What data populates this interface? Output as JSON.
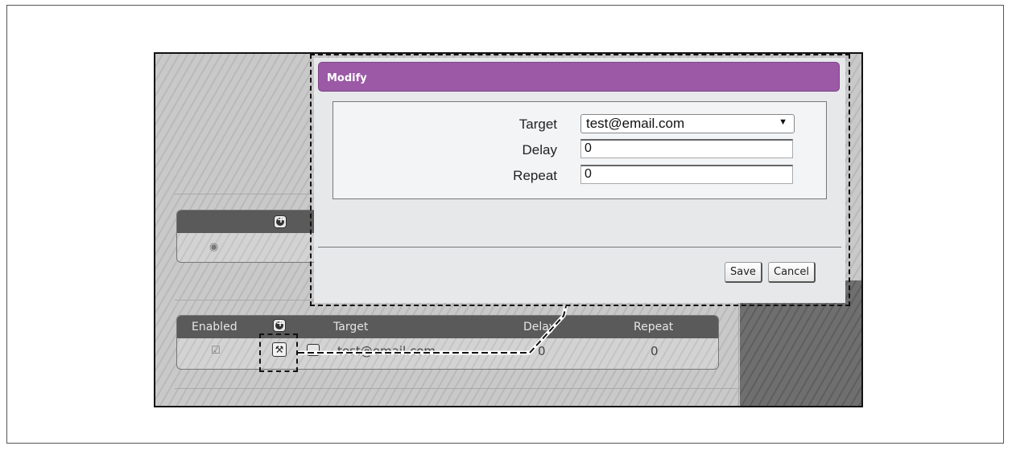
{
  "dialog": {
    "title": "Modify",
    "fields": {
      "target_label": "Target",
      "target_value": "test@email.com",
      "delay_label": "Delay",
      "delay_value": "0",
      "repeat_label": "Repeat",
      "repeat_value": "0"
    },
    "save_label": "Save",
    "cancel_label": "Cancel"
  },
  "targets_table": {
    "headers": {
      "enabled": "Enabled",
      "target": "Target",
      "delay": "Delay",
      "repeat": "Repeat"
    },
    "rows": [
      {
        "enabled": true,
        "target": "test@email.com",
        "delay": "0",
        "repeat": "0"
      }
    ]
  },
  "icons": {
    "modify": "wrench-icon",
    "add": "plus-icon",
    "delete": "delete-icon",
    "select_arrow": "▼"
  },
  "colors": {
    "dialog_title_bg": "#9b59a6",
    "table_header_bg": "#5a5a5a"
  }
}
